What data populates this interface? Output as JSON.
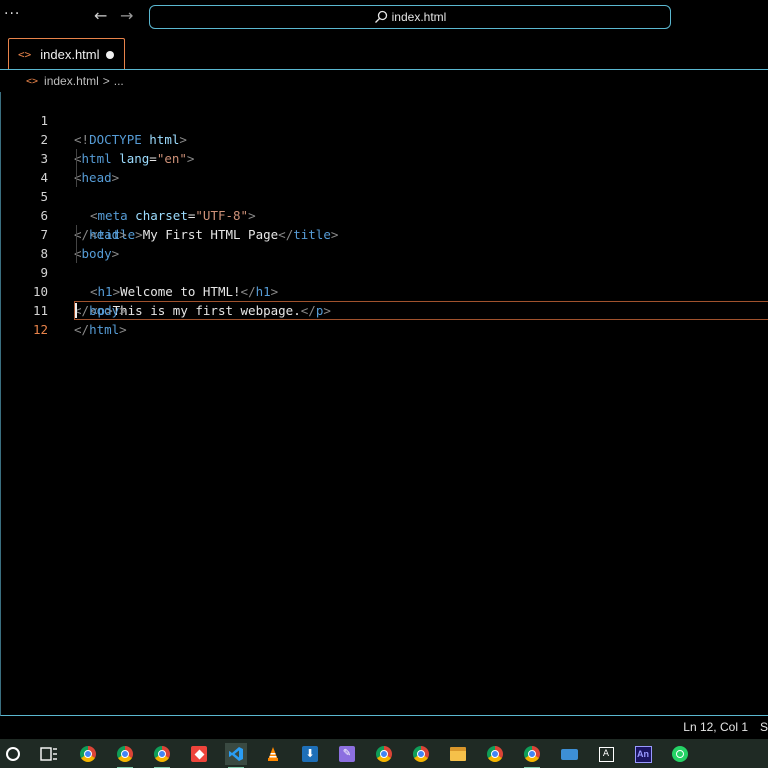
{
  "titlebar": {
    "menu_dots": "···",
    "back_arrow": "←",
    "forward_arrow": "→",
    "command_center": "index.html"
  },
  "tabs": [
    {
      "label": "index.html",
      "icon": "html-code-icon",
      "dirty": true
    }
  ],
  "breadcrumb": {
    "file": "index.html",
    "separator": ">",
    "more": "..."
  },
  "editor": {
    "line_numbers": [
      "1",
      "2",
      "3",
      "4",
      "5",
      "6",
      "7",
      "8",
      "9",
      "10",
      "11",
      "12"
    ],
    "active_line": "12",
    "lines": [
      "<!DOCTYPE html>",
      "<html lang=\"en\">",
      "<head>",
      "  <meta charset=\"UTF-8\">",
      "  <title>My First HTML Page</title>",
      "</head>",
      "<body>",
      "  <h1>Welcome to HTML!</h1>",
      "  <p>This is my first webpage.</p>",
      "</body>",
      "</html>",
      ""
    ]
  },
  "statusbar": {
    "position": "Ln 12, Col 1",
    "overflow_text": "S"
  },
  "colors": {
    "accent_border": "#5bb7d0",
    "tab_border": "#e8834a",
    "tag": "#569cd6",
    "attribute": "#9cdcfe",
    "string": "#ce9178",
    "taskbar": "#1f2a24"
  },
  "taskbar": {
    "icons": [
      "start-circle-icon",
      "task-view-icon",
      "chrome-icon",
      "chrome-icon",
      "chrome-icon",
      "anydesk-icon",
      "vscode-icon",
      "vlc-icon",
      "download-manager-icon",
      "notepad-icon",
      "chrome-icon",
      "chrome-icon",
      "file-explorer-icon",
      "chrome-icon",
      "chrome-icon",
      "keyboard-icon",
      "font-icon",
      "animate-icon",
      "whatsapp-icon"
    ],
    "animate_label": "An"
  }
}
